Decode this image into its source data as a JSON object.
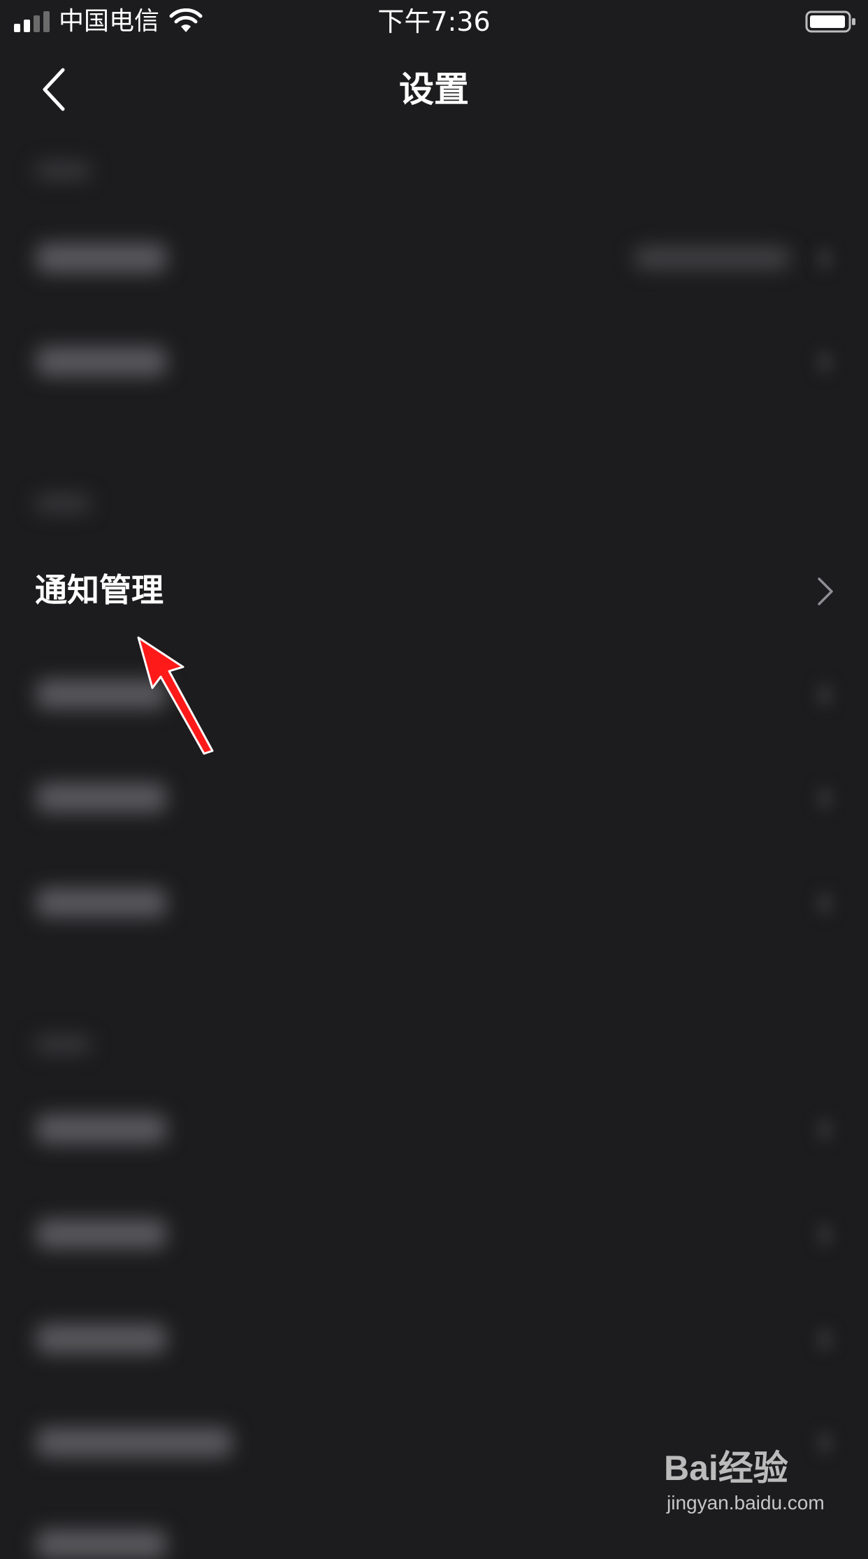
{
  "status_bar": {
    "carrier": "中国电信",
    "time": "下午7:36",
    "signal_bars": 2,
    "battery_level": 0.9
  },
  "nav": {
    "title": "设置",
    "back_icon": "chevron-left-icon"
  },
  "highlighted_item": {
    "label": "通知管理",
    "icon": "chevron-right-icon"
  },
  "annotation": {
    "color": "#ff1a1a",
    "icon": "red-arrow"
  },
  "watermark": {
    "brand": "Bai经验",
    "url": "jingyan.baidu.com"
  },
  "colors": {
    "background": "#1c1c1e",
    "text": "#ffffff"
  }
}
